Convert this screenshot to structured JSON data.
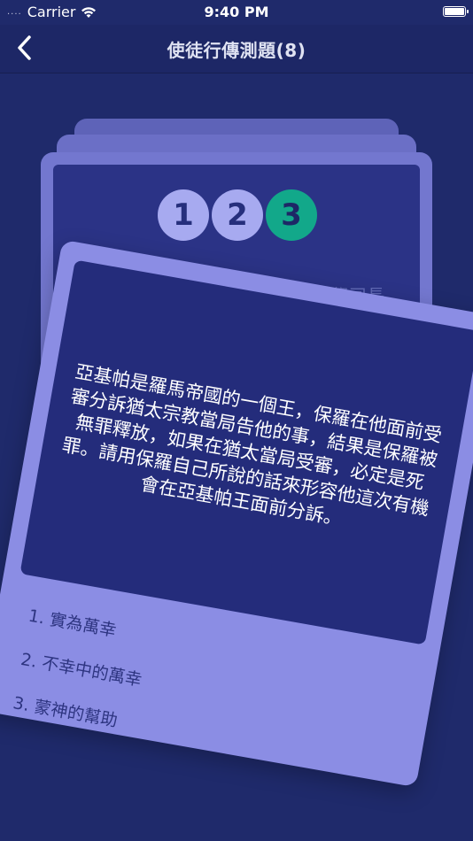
{
  "status_bar": {
    "signal_dots": "....",
    "carrier": "Carrier",
    "time": "9:40 PM"
  },
  "nav": {
    "title": "使徒行傳測題(8)",
    "back_icon": "chevron-left-icon"
  },
  "behind_card": {
    "partial_text": "祭司長"
  },
  "steps": [
    "1",
    "2",
    "3"
  ],
  "active_step": 3,
  "question": {
    "text": "亞基帕是羅馬帝國的一個王，保羅在他面前受審分訴猶太宗教當局告他的事，結果是保羅被無罪釋放，如果在猶太當局受審，必定是死罪。請用保羅自己所說的話來形容他這次有機會在亞基帕王面前分訴。"
  },
  "options": [
    "1. 實為萬幸",
    "2. 不幸中的萬幸",
    "3. 蒙神的幫助"
  ],
  "colors": {
    "background": "#1f2a6b",
    "card": "#8b8de4",
    "panel": "#242c7b",
    "step_done": "#a7aaf0",
    "step_active": "#12a88a"
  }
}
